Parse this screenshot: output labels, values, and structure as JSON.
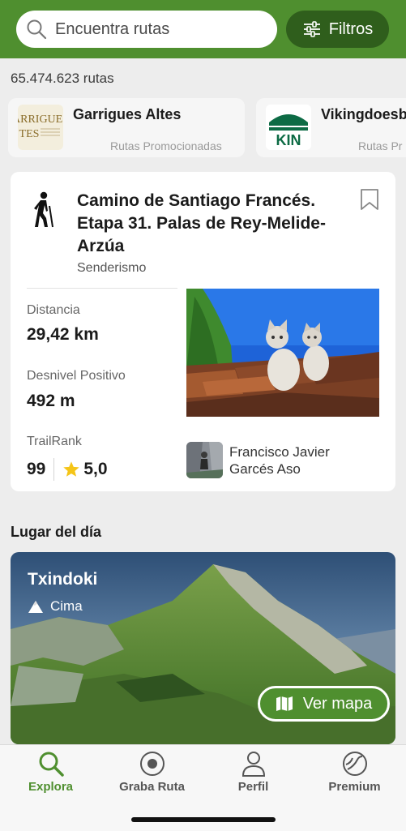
{
  "search": {
    "placeholder": "Encuentra rutas",
    "filters_label": "Filtros"
  },
  "results_count": "65.474.623 rutas",
  "promoted": [
    {
      "name": "Garrigues Altes",
      "tag": "Rutas Promocionadas",
      "logo_text": "ARRIGUES",
      "logo_text2": "TES"
    },
    {
      "name": "Vikingdoesb",
      "tag": "Rutas Pr",
      "logo_text": "KIN"
    }
  ],
  "route": {
    "title": "Camino de Santiago Francés. Etapa 31. Palas de Rey-Melide-Arzúa",
    "activity": "Senderismo",
    "distance_label": "Distancia",
    "distance_value": "29,42 km",
    "elevation_label": "Desnivel Positivo",
    "elevation_value": "492 m",
    "trailrank_label": "TrailRank",
    "trailrank_value": "99",
    "rating": "5,0",
    "author": "Francisco Javier Garcés Aso"
  },
  "place_of_day": {
    "section_title": "Lugar del día",
    "name": "Txindoki",
    "type": "Cima",
    "map_button": "Ver mapa"
  },
  "tabs": [
    {
      "label": "Explora",
      "icon": "search-icon",
      "active": true
    },
    {
      "label": "Graba Ruta",
      "icon": "record-icon",
      "active": false
    },
    {
      "label": "Perfil",
      "icon": "profile-icon",
      "active": false
    },
    {
      "label": "Premium",
      "icon": "premium-icon",
      "active": false
    }
  ],
  "colors": {
    "brand_green": "#4f8f2f",
    "dark_green": "#2f5e1c",
    "star": "#f5c518"
  }
}
